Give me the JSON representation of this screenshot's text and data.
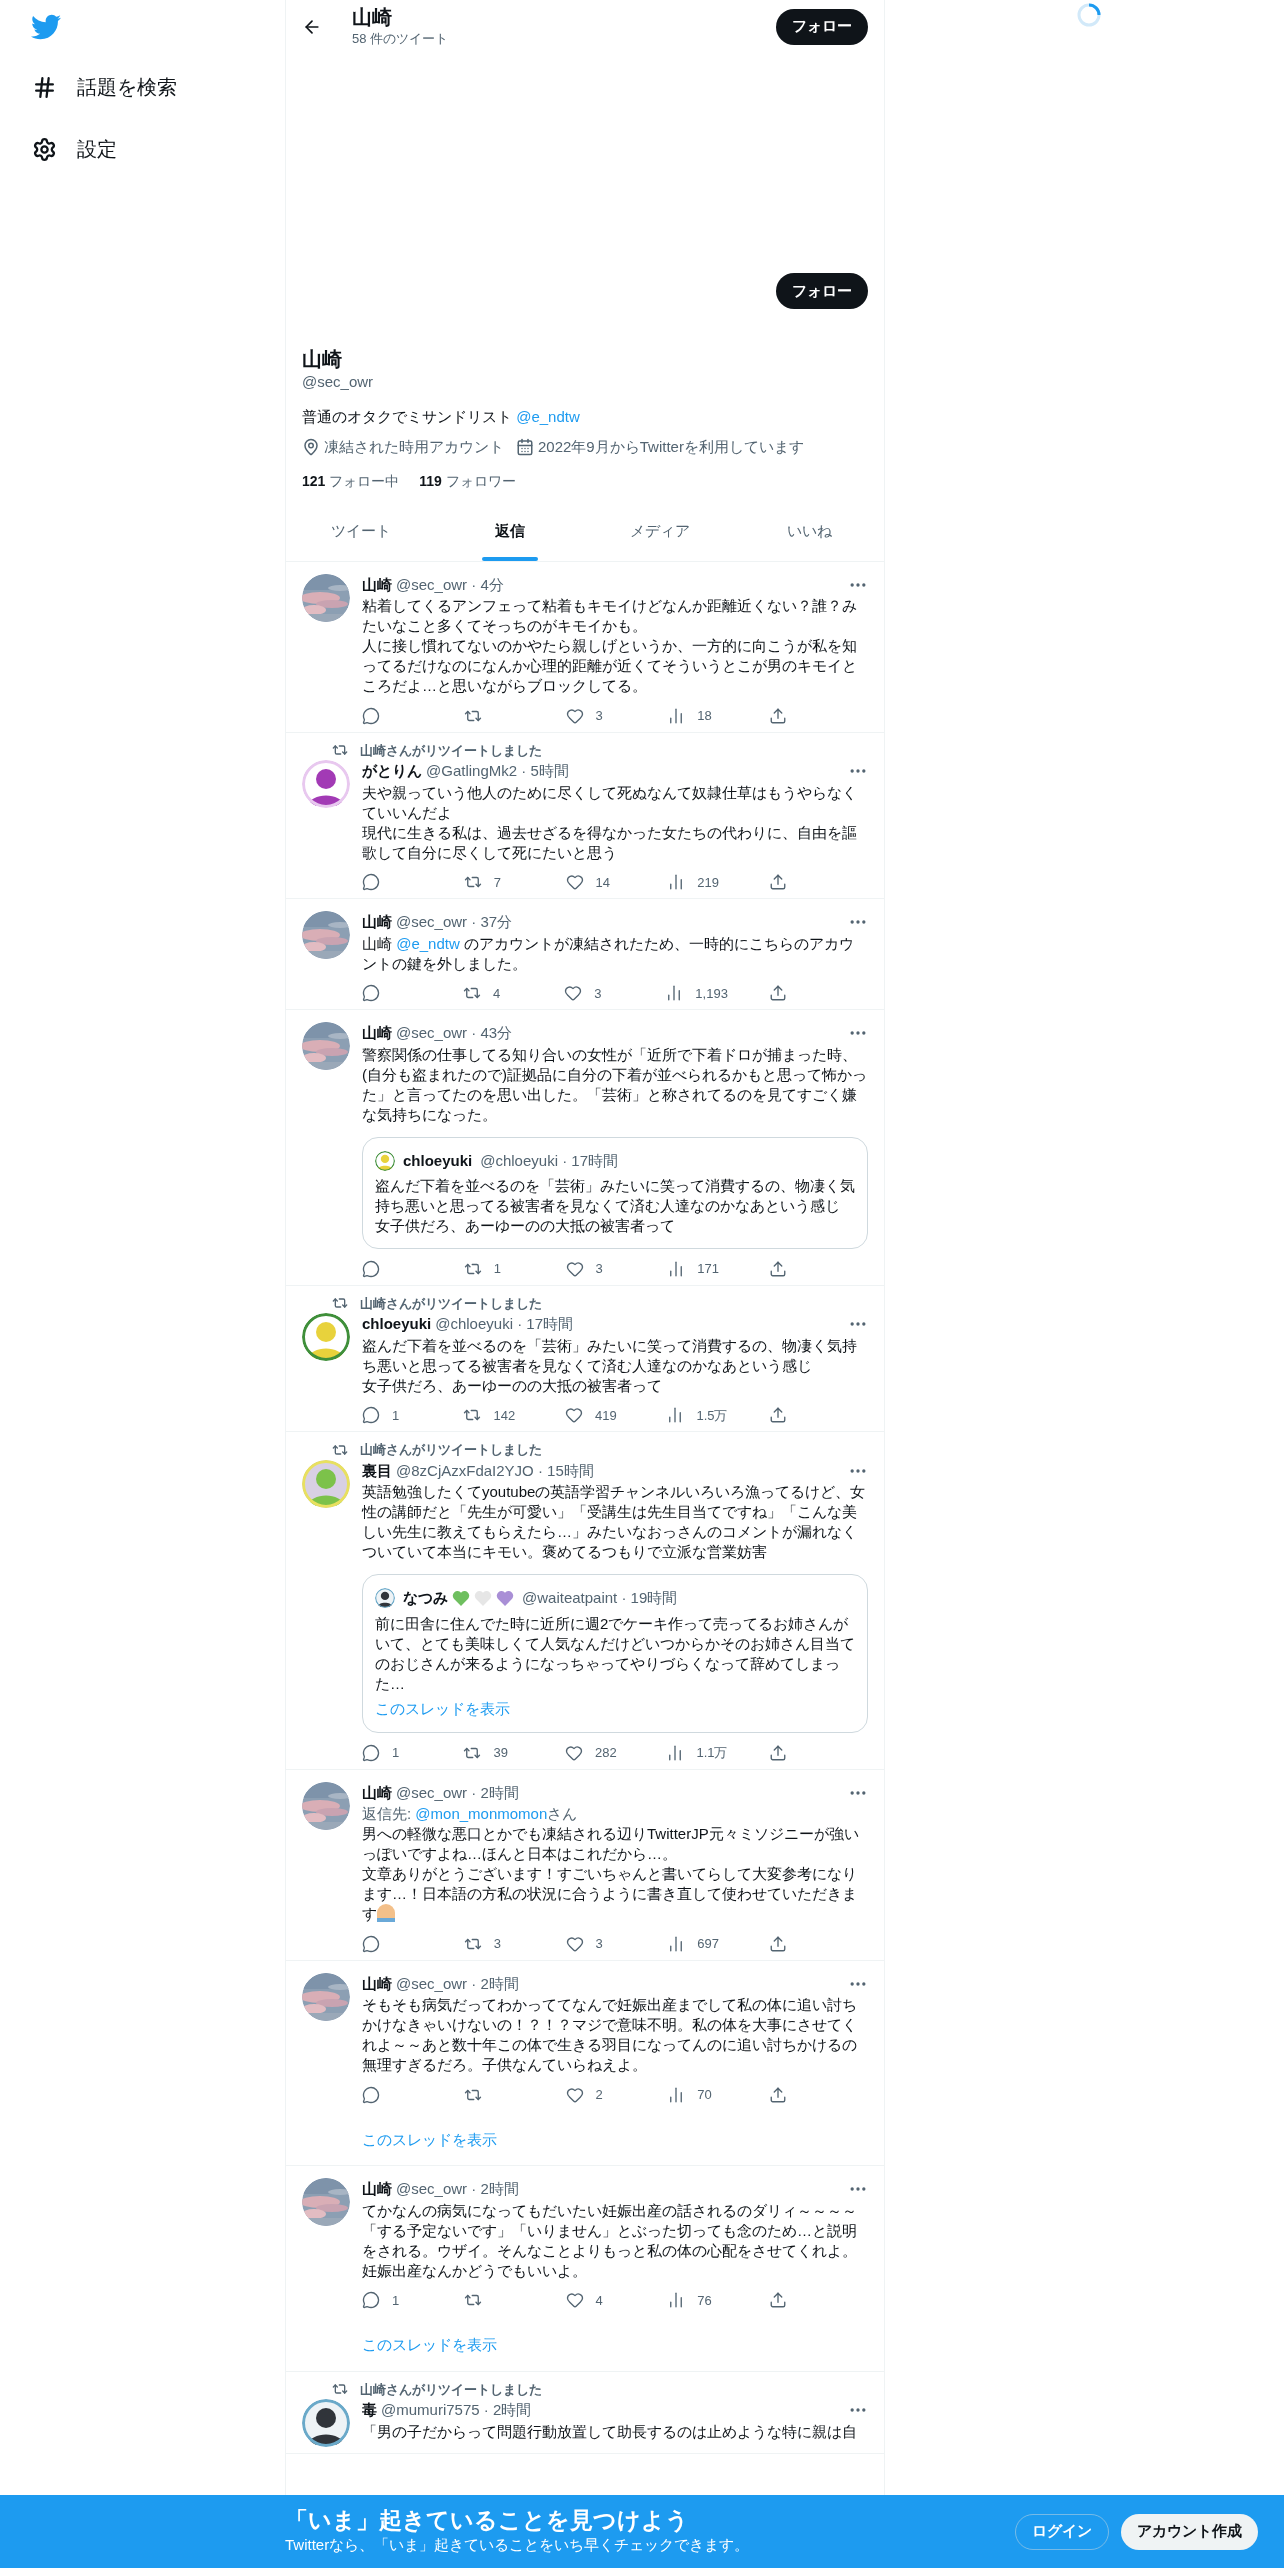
{
  "sidebar": {
    "items": [
      {
        "kind": "hash",
        "label": "話題を検索"
      },
      {
        "kind": "settings",
        "label": "設定"
      }
    ]
  },
  "header": {
    "title": "山崎",
    "subtitle": "58 件のツイート",
    "follow_button": "フォロー"
  },
  "profile": {
    "follow_button": "フォロー",
    "name": "山崎",
    "handle": "@sec_owr",
    "bio": "普通のオタクでミサンドリスト",
    "bio_link": "@e_ndtw",
    "location": "凍結された時用アカウント",
    "joined": "2022年9月からTwitterを利用しています",
    "following_count": "121",
    "following_label": "フォロー中",
    "followers_count": "119",
    "followers_label": "フォロワー"
  },
  "tabs": [
    {
      "label": "ツイート",
      "selected": false
    },
    {
      "label": "返信",
      "selected": true
    },
    {
      "label": "メディア",
      "selected": false
    },
    {
      "label": "いいね",
      "selected": false
    }
  ],
  "tweets": [
    {
      "avatar": {
        "kind": "sky"
      },
      "name": "山崎",
      "meta": "@sec_owr · 4分",
      "text": [
        {
          "kind": "text",
          "text": "粘着してくるアンフェって粘着もキモイけどなんか距離近くない？誰？みたいなこと多くてそっちのがキモイかも。"
        },
        {
          "kind": "break"
        },
        {
          "kind": "text",
          "text": "人に接し慣れてないのかやたら親しげというか、一方的に向こうが私を知ってるだけなのになんか心理的距離が近くてそういうとこが男のキモイところだよ…と思いながらブロックしてる。"
        }
      ],
      "stats": {
        "like": "3",
        "views": "18"
      }
    },
    {
      "retweeted_by": "山崎さんがリツイートしました",
      "avatar": {
        "kind": "purple"
      },
      "name": "がとりん",
      "meta": "@GatlingMk2 · 5時間",
      "text": [
        {
          "kind": "text",
          "text": "夫や親っていう他人のために尽くして死ぬなんて奴隷仕草はもうやらなくていいんだよ"
        },
        {
          "kind": "break"
        },
        {
          "kind": "text",
          "text": "現代に生きる私は、過去せざるを得なかった女たちの代わりに、自由を謳歌して自分に尽くして死にたいと思う"
        }
      ],
      "stats": {
        "retweet": "7",
        "like": "14",
        "views": "219"
      }
    },
    {
      "avatar": {
        "kind": "sky"
      },
      "name": "山崎",
      "meta": "@sec_owr · 37分",
      "text": [
        {
          "kind": "text",
          "text": "山崎 "
        },
        {
          "kind": "mention",
          "text": "@e_ndtw"
        },
        {
          "kind": "text",
          "text": " のアカウントが凍結されたため、一時的にこちらのアカウントの鍵を外しました。"
        }
      ],
      "stats": {
        "retweet": "4",
        "like": "3",
        "views": "1,193"
      }
    },
    {
      "avatar": {
        "kind": "sky"
      },
      "name": "山崎",
      "meta": "@sec_owr · 43分",
      "text": [
        {
          "kind": "text",
          "text": "警察関係の仕事してる知り合いの女性が「近所で下着ドロが捕まった時、(自分も盗まれたので)証拠品に自分の下着が並べられるかもと思って怖かった」と言ってたのを思い出した。「芸術」と称されてるのを見てすごく嫌な気持ちになった。"
        }
      ],
      "quote": {
        "avatar": {
          "kind": "yellow"
        },
        "name": "chloeyuki",
        "meta": "@chloeyuki · 17時間",
        "text": [
          {
            "kind": "text",
            "text": "盗んだ下着を並べるのを「芸術」みたいに笑って消費するの、物凄く気持ち悪いと思ってる被害者を見なくて済む人達なのかなあという感じ"
          },
          {
            "kind": "break"
          },
          {
            "kind": "text",
            "text": "女子供だろ、あーゆーのの大抵の被害者って"
          }
        ]
      },
      "stats": {
        "retweet": "1",
        "like": "3",
        "views": "171"
      }
    },
    {
      "retweeted_by": "山崎さんがリツイートしました",
      "avatar": {
        "kind": "yellow"
      },
      "name": "chloeyuki",
      "meta": "@chloeyuki · 17時間",
      "text": [
        {
          "kind": "text",
          "text": "盗んだ下着を並べるのを「芸術」みたいに笑って消費するの、物凄く気持ち悪いと思ってる被害者を見なくて済む人達なのかなあという感じ"
        },
        {
          "kind": "break"
        },
        {
          "kind": "text",
          "text": "女子供だろ、あーゆーのの大抵の被害者って"
        }
      ],
      "stats": {
        "reply": "1",
        "retweet": "142",
        "like": "419",
        "views": "1.5万"
      }
    },
    {
      "retweeted_by": "山崎さんがリツイートしました",
      "avatar": {
        "kind": "green"
      },
      "name": "裏目",
      "meta": "@8zCjAzxFdaI2YJO · 15時間",
      "text": [
        {
          "kind": "text",
          "text": "英語勉強したくてyoutubeの英語学習チャンネルいろいろ漁ってるけど、女性の講師だと「先生が可愛い」「受講生は先生目当てですね」「こんな美しい先生に教えてもらえたら…」みたいなおっさんのコメントが漏れなくついていて本当にキモい。褒めてるつもりで立派な営業妨害"
        }
      ],
      "quote": {
        "avatar": {
          "kind": "dark"
        },
        "name": "なつみ",
        "hearts": [
          {
            "color": "#6fbf5f"
          },
          {
            "color": "#e6e6e6"
          },
          {
            "color": "#a98fd6"
          }
        ],
        "meta": "@waiteatpaint · 19時間",
        "text": [
          {
            "kind": "text",
            "text": "前に田舎に住んでた時に近所に週2でケーキ作って売ってるお姉さんがいて、とても美味しくて人気なんだけどいつからかそのお姉さん目当てのおじさんが来るようになっちゃってやりづらくなって辞めてしまった…"
          }
        ],
        "show_thread": "このスレッドを表示"
      },
      "stats": {
        "reply": "1",
        "retweet": "39",
        "like": "282",
        "views": "1.1万"
      }
    },
    {
      "avatar": {
        "kind": "sky"
      },
      "name": "山崎",
      "meta": "@sec_owr · 2時間",
      "reply_to": {
        "prefix": "返信先: ",
        "link": "@mon_monmomon",
        "suffix": "さん"
      },
      "text": [
        {
          "kind": "text",
          "text": "男への軽微な悪口とかでも凍結される辺りTwitterJP元々ミソジニーが強いっぽいですよね…ほんと日本はこれだから…。"
        },
        {
          "kind": "break"
        },
        {
          "kind": "text",
          "text": "文章ありがとうございます！すごいちゃんと書いてらして大変参考になります…！日本語の方私の状況に合うように書き直して使わせていただきます"
        },
        {
          "kind": "pray"
        }
      ],
      "stats": {
        "retweet": "3",
        "like": "3",
        "views": "697"
      }
    },
    {
      "avatar": {
        "kind": "sky"
      },
      "name": "山崎",
      "meta": "@sec_owr · 2時間",
      "text": [
        {
          "kind": "text",
          "text": "そもそも病気だってわかっててなんで妊娠出産までして私の体に追い討ちかけなきゃいけないの！？！？マジで意味不明。私の体を大事にさせてくれよ～～あと数十年この体で生きる羽目になってんのに追い討ちかけるの無理すぎるだろ。子供なんていらねえよ。"
        }
      ],
      "stats": {
        "like": "2",
        "views": "70"
      },
      "show_thread": "このスレッドを表示"
    },
    {
      "avatar": {
        "kind": "sky"
      },
      "name": "山崎",
      "meta": "@sec_owr · 2時間",
      "text": [
        {
          "kind": "text",
          "text": "てかなんの病気になってもだいたい妊娠出産の話されるのダリィ～～～～「する予定ないです」「いりません」とぶった切っても念のため…と説明をされる。ウザイ。そんなことよりもっと私の体の心配をさせてくれよ。妊娠出産なんかどうでもいいよ。"
        }
      ],
      "stats": {
        "reply": "1",
        "like": "4",
        "views": "76"
      },
      "show_thread": "このスレッドを表示"
    },
    {
      "retweeted_by": "山崎さんがリツイートしました",
      "avatar": {
        "kind": "dark"
      },
      "name": "毒",
      "meta": "@mumuri7575 · 2時間",
      "text": [
        {
          "kind": "text",
          "text": "「男の子だからって問題行動放置して助長するのは止めような特に親は自"
        }
      ]
    }
  ],
  "banner": {
    "title": "「いま」起きていることを見つけよう",
    "subtitle": "Twitterなら、「いま」起きていることをいち早くチェックできます。",
    "login_button": "ログイン",
    "signup_button": "アカウント作成"
  }
}
